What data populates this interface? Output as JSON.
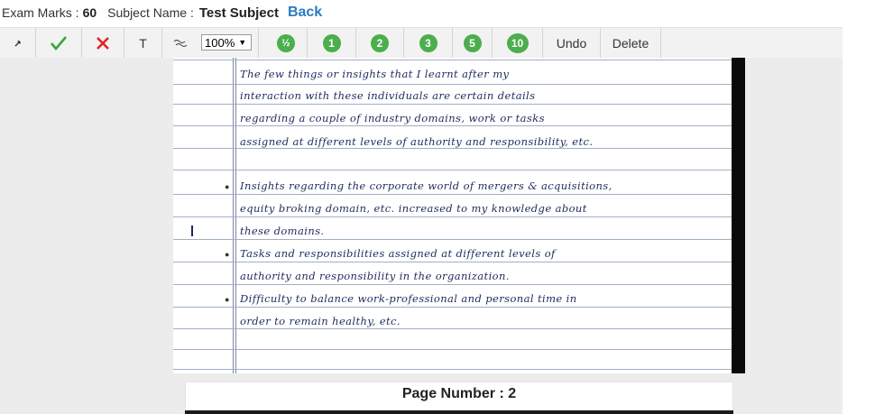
{
  "header": {
    "exam_marks_label": "Exam Marks :",
    "exam_marks_value": "60",
    "subject_label": "Subject Name :",
    "subject_value": "Test Subject",
    "back_label": "Back"
  },
  "toolbar": {
    "zoom_value": "100%",
    "text_tool_label": "T",
    "marks": [
      "½",
      "1",
      "2",
      "3",
      "5",
      "10"
    ],
    "undo_label": "Undo",
    "delete_label": "Delete"
  },
  "answer_sheet": {
    "lines": [
      "The few things or insights that I learnt after my",
      "interaction with these individuals are certain details",
      "regarding a couple of industry domains, work or tasks",
      "assigned at different levels of authority and responsibility, etc.",
      "Insights regarding the corporate world of mergers & acquisitions,",
      "equity broking domain, etc. increased to my knowledge about",
      "these domains.",
      "Tasks and responsibilities assigned at different levels of",
      "authority and responsibility in the organization.",
      "Difficulty to balance work-professional and personal time in",
      "order to remain healthy, etc."
    ]
  },
  "footer": {
    "page_number_label": "Page Number : 2"
  }
}
